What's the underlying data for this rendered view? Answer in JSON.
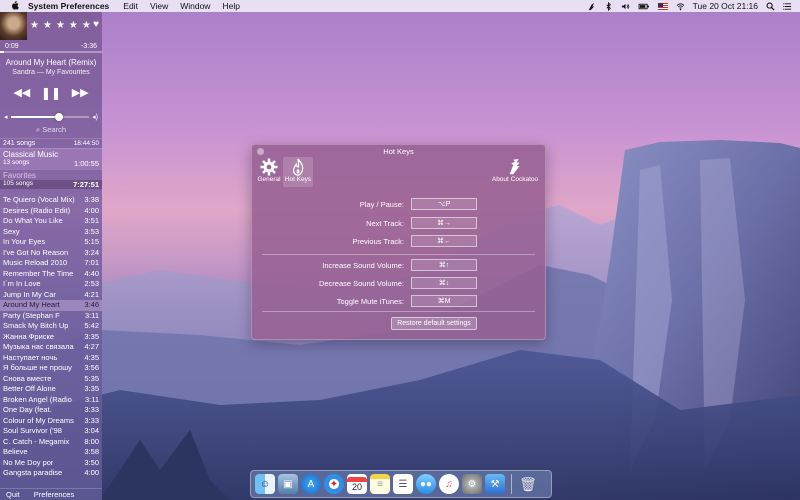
{
  "menubar": {
    "app_name": "System Preferences",
    "items": [
      "Edit",
      "View",
      "Window",
      "Help"
    ],
    "clock": "Tue 20 Oct  21:16"
  },
  "player": {
    "time_elapsed": "0:09",
    "time_remaining": "-3:36",
    "progress_fraction": 0.04,
    "volume_fraction": 0.62,
    "track_title": "Around My Heart (Remix)",
    "track_subtitle": "Sandra — My Favourites",
    "search_placeholder": "Search",
    "playlists": [
      {
        "left": "241 songs",
        "right": "18:44:50"
      },
      {
        "name": "Classical Music",
        "left": "13 songs",
        "right": "1:00:55"
      },
      {
        "name": "Favorites",
        "left": "105 songs",
        "right": "7:27:51"
      }
    ],
    "songs": [
      {
        "title": "Te Quiero (Vocal Mix)",
        "time": "3:38"
      },
      {
        "title": "Desires (Radio Edit)",
        "time": "4:00"
      },
      {
        "title": "Do What You Like",
        "time": "3:51"
      },
      {
        "title": "Sexy",
        "time": "3:53"
      },
      {
        "title": "In Your Eyes",
        "time": "5:15"
      },
      {
        "title": "I've Got No Reason",
        "time": "3:24"
      },
      {
        "title": "Music Reload 2010",
        "time": "7:01"
      },
      {
        "title": "Remember The Time",
        "time": "4:40"
      },
      {
        "title": "I´m In Love",
        "time": "2:53"
      },
      {
        "title": "Jump In My Car",
        "time": "4:21"
      },
      {
        "title": "Around My Heart",
        "time": "3:46"
      },
      {
        "title": "Party (Stephan F",
        "time": "3:11"
      },
      {
        "title": "Smack My Bitch Up",
        "time": "5:42"
      },
      {
        "title": "Жанна Фриске",
        "time": "3:35"
      },
      {
        "title": "Музыка нас связала",
        "time": "4:27"
      },
      {
        "title": "Наступает ночь",
        "time": "4:35"
      },
      {
        "title": "Я больше не прошу",
        "time": "3:56"
      },
      {
        "title": "Снова вместе",
        "time": "5:35"
      },
      {
        "title": "Better Off Alone",
        "time": "3:35"
      },
      {
        "title": "Broken Angel (Radio",
        "time": "3:11"
      },
      {
        "title": "One Day (feat.",
        "time": "3:33"
      },
      {
        "title": "Colour of My Dreams",
        "time": "3:33"
      },
      {
        "title": "Soul Survivor ('98",
        "time": "3:04"
      },
      {
        "title": "C. Catch - Megamix",
        "time": "8:00"
      },
      {
        "title": "Believe",
        "time": "3:58"
      },
      {
        "title": "No Me Doy por",
        "time": "3:50"
      },
      {
        "title": "Gangsta paradise",
        "time": "4:00"
      }
    ],
    "current_song_index": 10,
    "footer": {
      "quit": "Quit",
      "preferences": "Preferences"
    }
  },
  "hotkeys": {
    "title": "Hot Keys",
    "toolbar": {
      "general": "General",
      "hot_keys": "Hot Keys",
      "about": "About Cockatoo"
    },
    "rows": [
      {
        "label": "Play / Pause:",
        "value": "⌥P"
      },
      {
        "label": "Next Track:",
        "value": "⌘→"
      },
      {
        "label": "Previous Track:",
        "value": "⌘←"
      },
      {
        "label": "Increase Sound Volume:",
        "value": "⌘↑"
      },
      {
        "label": "Decrease Sound Volume:",
        "value": "⌘↓"
      },
      {
        "label": "Toggle Mute iTunes:",
        "value": "⌘M"
      }
    ],
    "restore_button": "Restore default settings"
  },
  "dock": {
    "calendar_day": "20",
    "icons": [
      "finder-icon",
      "preview-icon",
      "app-store-icon",
      "safari-icon",
      "calendar-icon",
      "notes-icon",
      "reminders-icon",
      "messages-icon",
      "itunes-icon",
      "system-preferences-icon",
      "xcode-icon",
      "trash-icon"
    ]
  }
}
